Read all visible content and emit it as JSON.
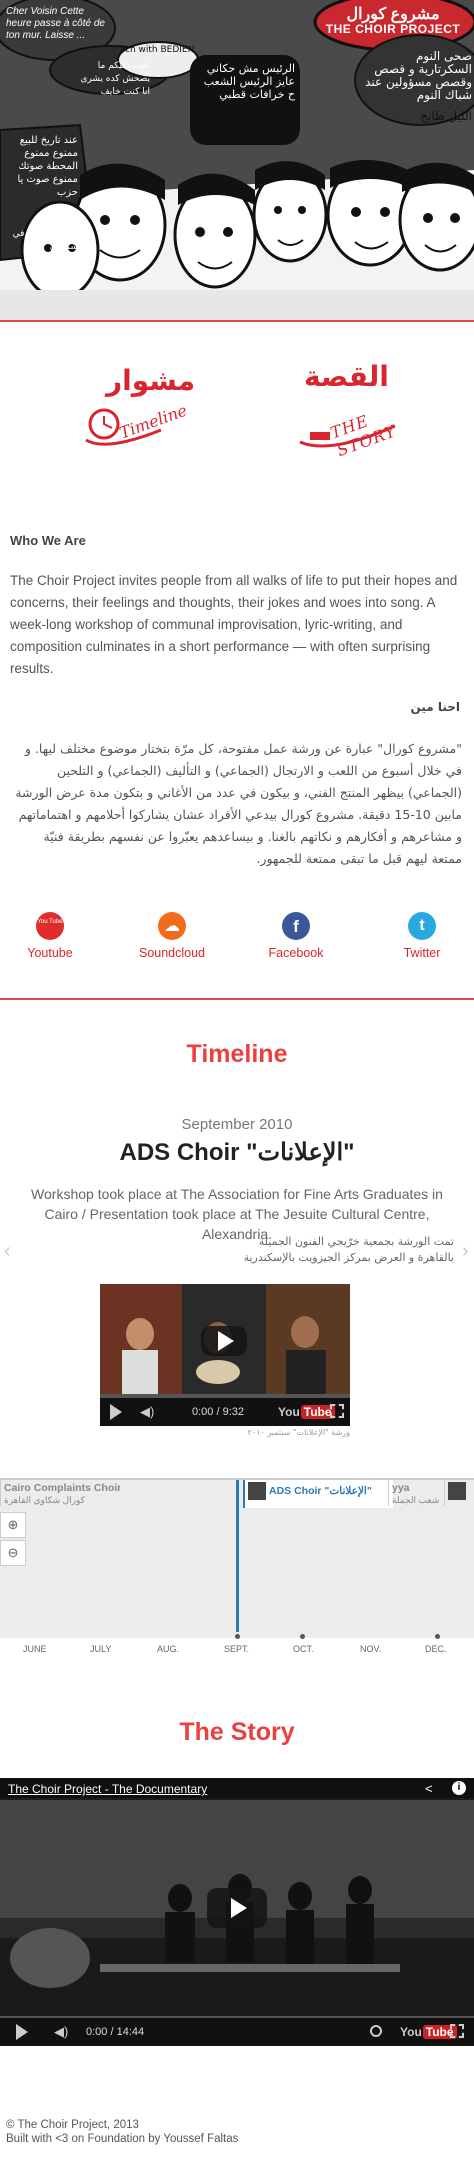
{
  "hero": {
    "brand_ar": "مشروع كورال",
    "brand_en": "THE CHOIR PROJECT",
    "bubble_fr": "Cher Voisin Cette heure passe à côté de ton mur. Laisse ...",
    "bubble_tl_ar": "عيب عليكم ما يصحش كده يشرى انا كنت خايف",
    "bubble_mid_en": "lich with BEDIEN",
    "bubble_center_ar": "الرئيس مش حكاني عايز الرئيس الشعب ح خرافات قطبي",
    "bubble_right_ar": "صحى النوم السكرتارية و قصص وقصص مسؤولين عند شباك النوم",
    "bubble_right2_ar": "الليل طابخ",
    "bubble_left_ar": "عند تاريخ للبيع ممنوع ممنوع المحطة صوتك ممنوع صوت يا حزب",
    "bubble_left2_ar": "صوت يا حزب في شمسي"
  },
  "badges": {
    "timeline_ar": "مشوار",
    "timeline_en": "Timeline",
    "story_ar": "القصة",
    "story_en": "THE STORY"
  },
  "who": {
    "title": "Who We Are",
    "body": "The Choir Project invites people from all walks of life to put their hopes and concerns, their feelings and thoughts, their jokes and woes into song. A week-long workshop of communal improvisation, lyric-writing, and composition culminates in a short performance — with often surprising results.",
    "ar_title": "احنا مين",
    "ar_body": "\"مشروع كورال\" عبارة عن ورشة عمل مفتوحة، كل مرّة بتختار موضوع مختلف ليها. و في خلال أسبوع من اللعب و الارتجال (الجماعي) و التأليف (الجماعي) و التلحين (الجماعي) بيظهر المنتج الفني، و بيكون في عدد من الأغاني و بتكون مدة عرض الورشة مابين 10-15 دقيقة. مشروع كورال بيدعي الأفراد عشان يشاركوا أحلامهم و اهتماماتهم و مشاعرهم و أفكارهم و نكاتهم بالغنا. و بيساعدهم يعبّروا عن نفسهم بطريقة فنيّة ممتعة ليهم قبل ما تبقى ممتعة للجمهور."
  },
  "social": [
    {
      "label": "Youtube",
      "icon": "youtube-icon",
      "color": "#e22b2b",
      "glyph": "You Tube"
    },
    {
      "label": "Soundcloud",
      "icon": "soundcloud-icon",
      "color": "#f26b1d",
      "glyph": "☁"
    },
    {
      "label": "Facebook",
      "icon": "facebook-icon",
      "color": "#3b5998",
      "glyph": "f"
    },
    {
      "label": "Twitter",
      "icon": "twitter-icon",
      "color": "#2aa9e0",
      "glyph": "t"
    }
  ],
  "timeline": {
    "section_title": "Timeline",
    "date": "September 2010",
    "headline": "ADS Choir \"الإعلانات\"",
    "desc": "Workshop took place at The Association for Fine Arts Graduates in Cairo / Presentation took place at The Jesuite Cultural Centre, Alexandria.",
    "desc_ar": "تمت الورشة بجمعية خرّيجي الفنون الجميلة بالقاهرة و العرض بمركز الجيزويت بالإسكندرية",
    "video_time": "0:00 / 9:32",
    "video_caption": "ورشة \"الإعلانات\" سبتمبر ٢٠١٠",
    "markers": [
      {
        "title": "Cairo Complaints Choir",
        "sub": "كورال شكاوي القاهرة"
      },
      {
        "title": "ADS Choir \"الإعلانات\"",
        "sub": ""
      },
      {
        "title": "yya",
        "sub": "شعب الجملة"
      },
      {
        "title": "",
        "sub": ""
      }
    ],
    "zoom_in": "⊕",
    "zoom_out": "⊖",
    "months": [
      "JUNE",
      "JULY",
      "AUG.",
      "SEPT.",
      "OCT.",
      "NOV.",
      "DEC."
    ]
  },
  "story": {
    "section_title": "The Story",
    "video_title": "The Choir Project - The Documentary",
    "video_time": "0:00 / 14:44"
  },
  "footer": {
    "copyright": "© The Choir Project, 2013",
    "built": "Built with <3 on Foundation by Youssef Faltas"
  },
  "colors": {
    "accent": "#e8413f",
    "timeline_blue": "#2d78b7"
  }
}
